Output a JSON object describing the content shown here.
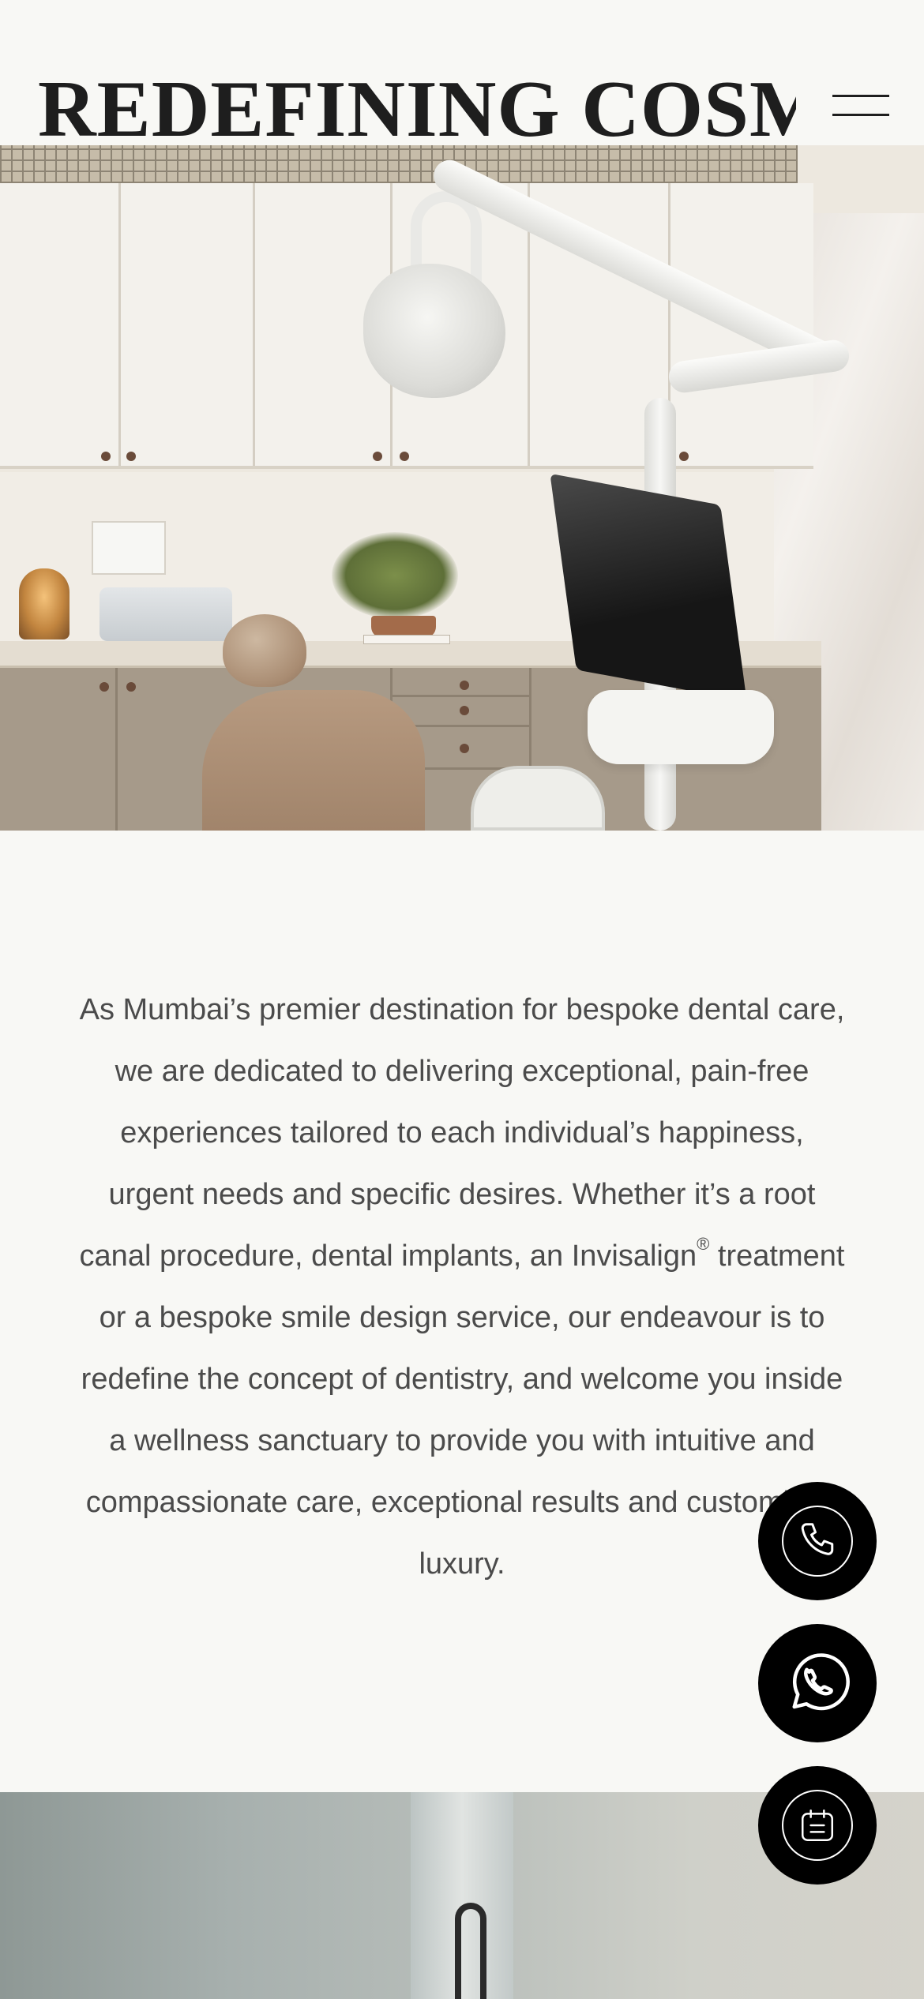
{
  "header": {
    "title": "REDEFINING COSMET",
    "menu_icon": "hamburger-icon"
  },
  "hero": {
    "image_description_icon": "dental-clinic-photo"
  },
  "intro": {
    "text_before_mark": "As Mumbai’s premier destination for bespoke dental care, we are dedicated to delivering exceptional, pain-free experiences tailored to each individual’s happiness, urgent needs and specific desires. Whether it’s a root canal procedure, dental implants, an Invisalign",
    "registered_mark": "®",
    "text_after_mark": " treatment or a bespoke smile design service, our endeavour is to redefine the concept of dentistry, and welcome you inside a wellness sanctuary to provide you with intuitive and compassionate care, exceptional results and customised luxury."
  },
  "fabs": [
    {
      "icon": "phone-icon"
    },
    {
      "icon": "whatsapp-icon"
    },
    {
      "icon": "calendar-icon"
    }
  ],
  "colors": {
    "background": "#f8f8f5",
    "text": "#4b4b4b",
    "title": "#1e1e1e",
    "fab": "#000000"
  }
}
